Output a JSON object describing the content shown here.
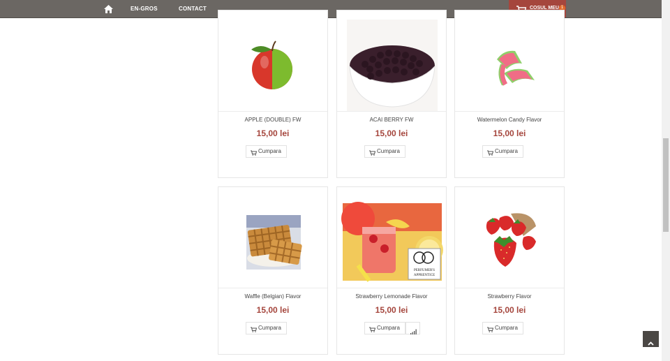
{
  "nav": {
    "home_icon": "home-icon",
    "links": [
      "EN-GROS",
      "CONTACT"
    ],
    "cart_label": "COSUL MEU",
    "cart_count": "1",
    "cart_color": "#a5463d"
  },
  "products": [
    {
      "name": "APPLE (DOUBLE) FW",
      "price": "15,00 lei",
      "buy_label": "Cumpara"
    },
    {
      "name": "ACAI BERRY FW",
      "price": "15,00 lei",
      "buy_label": "Cumpara"
    },
    {
      "name": "Watermelon Candy Flavor",
      "price": "15,00 lei",
      "buy_label": "Cumpara"
    },
    {
      "name": "Waffle (Belgian) Flavor",
      "price": "15,00 lei",
      "buy_label": "Cumpara"
    },
    {
      "name": "Strawberry Lemonade Flavor",
      "price": "15,00 lei",
      "buy_label": "Cumpara"
    },
    {
      "name": "Strawberry Flavor",
      "price": "15,00 lei",
      "buy_label": "Cumpara"
    }
  ],
  "badge_text": {
    "line1": "PERFUMER'S",
    "line2": "APPRENTICE"
  },
  "back_to_top_icon": "chevron-up-icon"
}
